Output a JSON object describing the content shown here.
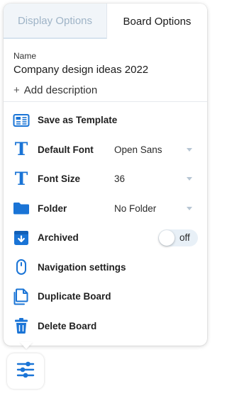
{
  "tabs": [
    {
      "label": "Display Options",
      "active": false
    },
    {
      "label": "Board Options",
      "active": true
    }
  ],
  "board": {
    "name_label": "Name",
    "name_value": "Company design ideas 2022",
    "add_description": "Add description",
    "add_description_icon": "plus"
  },
  "options": {
    "save_template": {
      "label": "Save as Template",
      "icon": "template-icon"
    },
    "default_font": {
      "label": "Default Font",
      "value": "Open Sans",
      "icon": "font-icon"
    },
    "font_size": {
      "label": "Font Size",
      "value": "36",
      "icon": "font-size-icon"
    },
    "folder": {
      "label": "Folder",
      "value": "No Folder",
      "icon": "folder-icon"
    },
    "archived": {
      "label": "Archived",
      "toggle_text": "off",
      "on": false,
      "icon": "archive-icon"
    },
    "navigation": {
      "label": "Navigation settings",
      "icon": "mouse-icon"
    },
    "duplicate": {
      "label": "Duplicate Board",
      "icon": "duplicate-icon"
    },
    "delete": {
      "label": "Delete Board",
      "icon": "trash-icon"
    }
  },
  "settings_button": {
    "icon": "sliders-icon"
  },
  "colors": {
    "accent": "#1a74d6",
    "inactive_tab_bg": "#f1f5f9",
    "inactive_tab_text": "#9fb4c7",
    "toggle_bg": "#e8f0f7"
  }
}
